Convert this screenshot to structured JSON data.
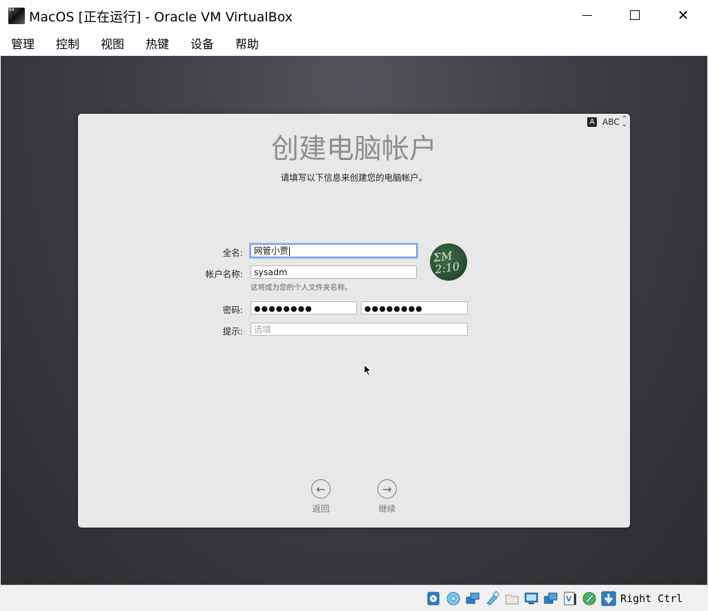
{
  "window": {
    "title": "MacOS [正在运行] - Oracle VM VirtualBox",
    "minimize_glyph": "─",
    "close_glyph": "✕"
  },
  "menu": {
    "items": [
      {
        "label": "管理"
      },
      {
        "label": "控制"
      },
      {
        "label": "视图"
      },
      {
        "label": "热键"
      },
      {
        "label": "设备"
      },
      {
        "label": "帮助"
      }
    ]
  },
  "setup": {
    "input_source": {
      "badge": "A",
      "label": "ABC"
    },
    "heading": "创建电脑帐户",
    "subheading": "请填写以下信息来创建您的电脑帐户。",
    "full_name": {
      "label": "全名:",
      "value": "网管小贾"
    },
    "account_name": {
      "label": "帐户名称:",
      "value": "sysadm",
      "note": "这将成为您的个人文件夹名称。"
    },
    "password": {
      "label": "密码:",
      "value": "●●●●●●●●",
      "verify_value": "●●●●●●●●"
    },
    "hint": {
      "label": "提示:",
      "placeholder": "选填"
    },
    "avatar": {
      "text_line1": "ΣM",
      "text_line2": "2:10"
    },
    "back": {
      "label": "返回",
      "glyph": "←"
    },
    "continue": {
      "label": "继续",
      "glyph": "→"
    }
  },
  "statusbar": {
    "icons": [
      "hard-disk-icon",
      "optical-disk-icon",
      "network-icon",
      "usb-icon",
      "shared-folders-icon",
      "display-icon",
      "video-capture-icon",
      "cpu-icon",
      "mouse-integration-icon",
      "host-key-arrow-icon"
    ],
    "host_key": "Right Ctrl"
  }
}
